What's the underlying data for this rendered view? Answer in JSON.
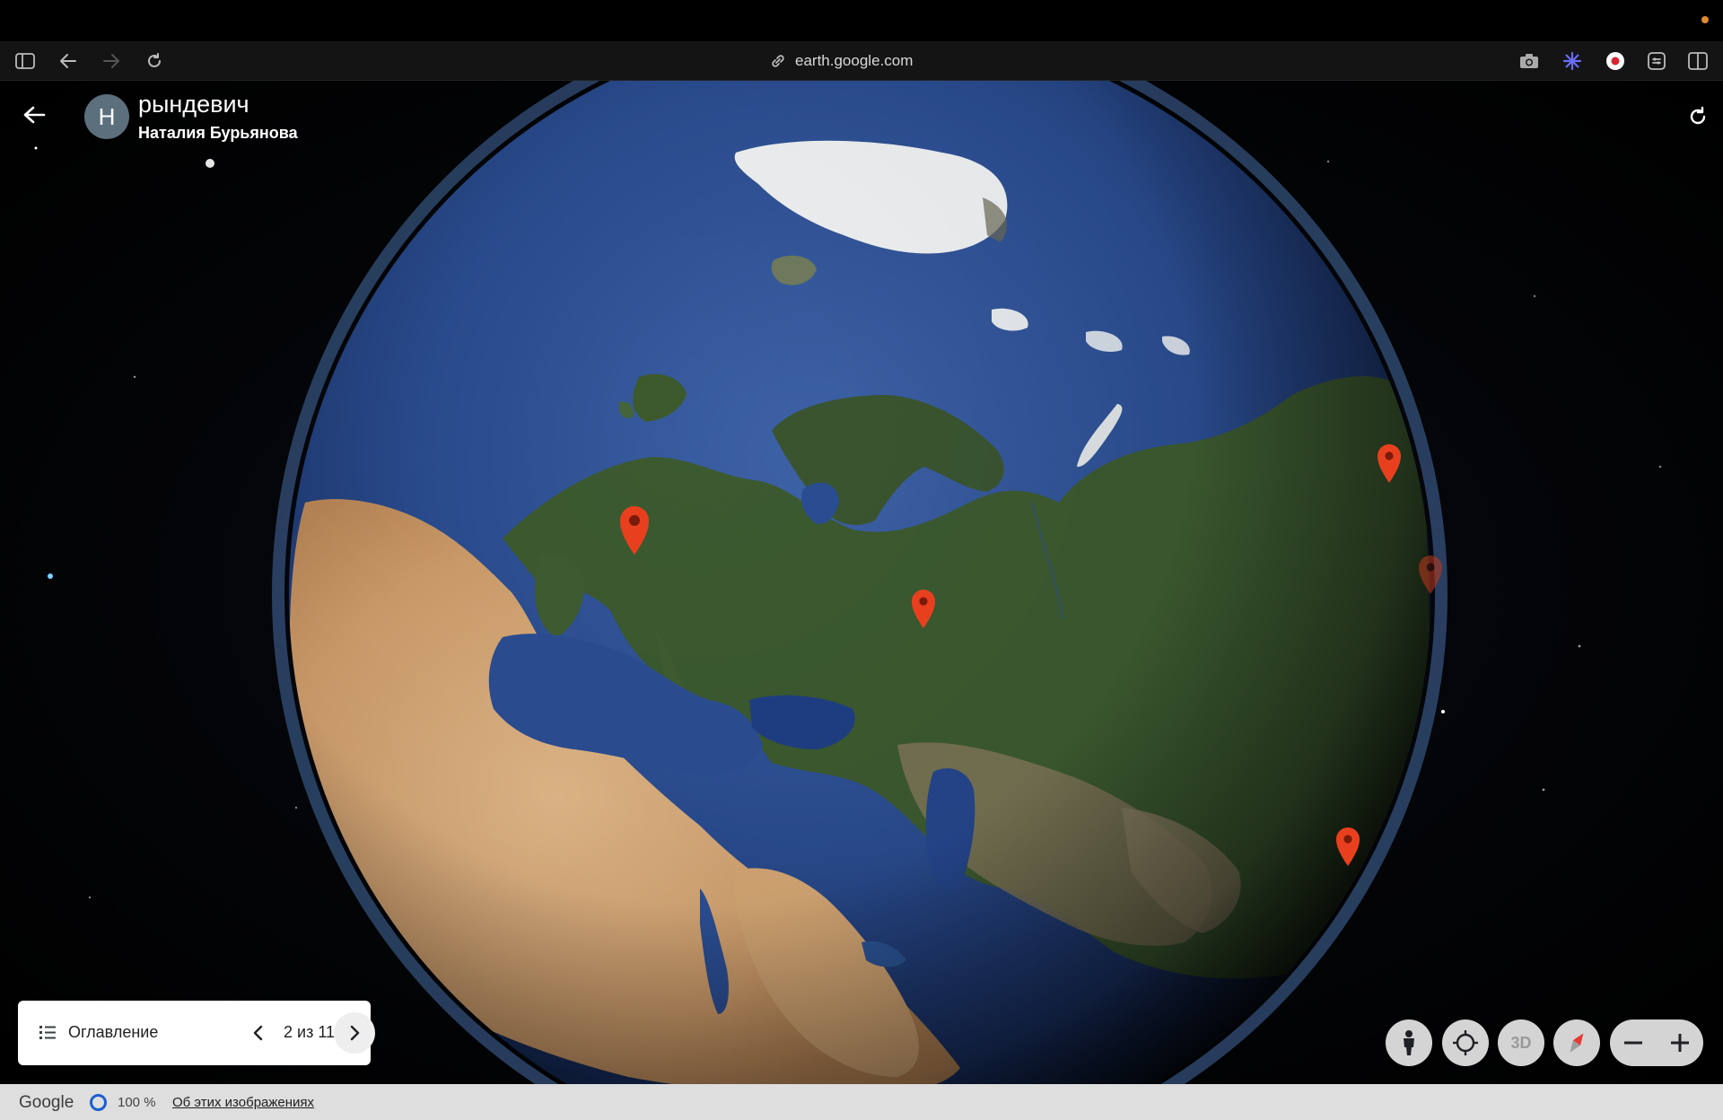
{
  "browser": {
    "url": "earth.google.com"
  },
  "story": {
    "title": "рындевич",
    "author": "Наталия Бурьянова",
    "avatar_letter": "Н"
  },
  "toc": {
    "label": "Оглавление",
    "counter": "2 из 11"
  },
  "controls": {
    "threed_label": "3D"
  },
  "statusbar": {
    "brand": "Google",
    "zoom_percent": "100 %",
    "imagery_link": "Об этих изображениях"
  },
  "colors": {
    "placemark": "#e8401e",
    "accent_blue": "#1a5fd0"
  },
  "placemarks": [
    {
      "name": "placemark-europe-alps"
    },
    {
      "name": "placemark-western-siberia"
    },
    {
      "name": "placemark-far-east-north"
    },
    {
      "name": "placemark-far-east-limb"
    },
    {
      "name": "placemark-far-east-south"
    }
  ]
}
